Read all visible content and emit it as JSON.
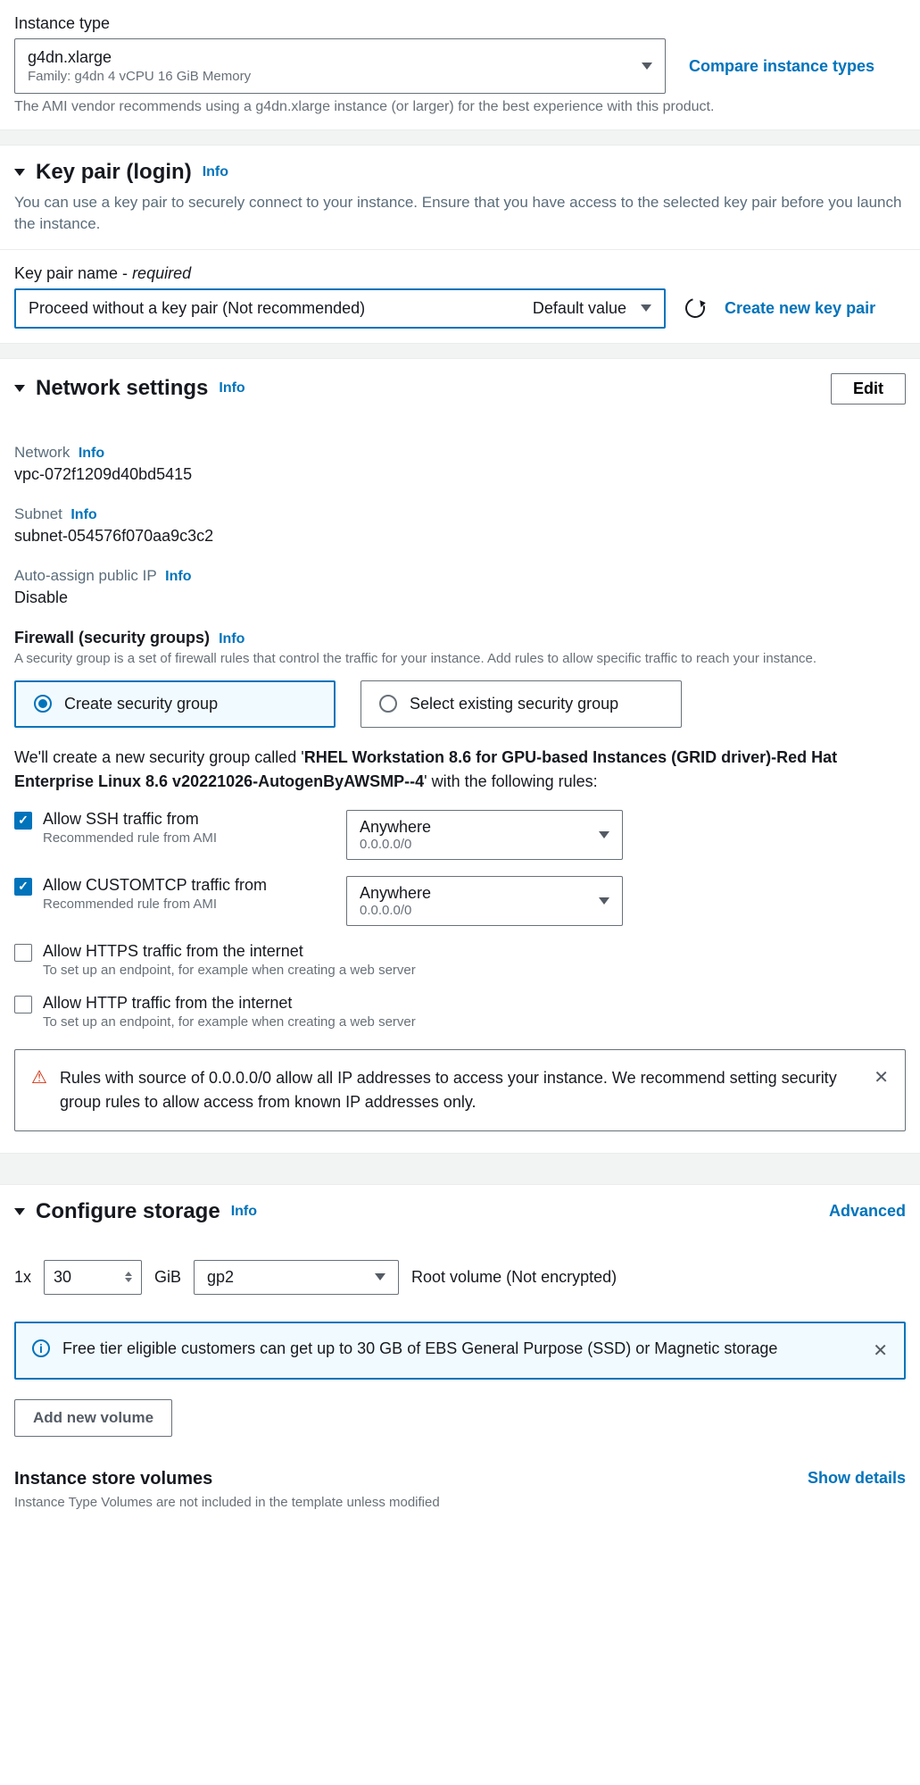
{
  "instanceType": {
    "label": "Instance type",
    "value": "g4dn.xlarge",
    "details": "Family: g4dn    4 vCPU    16 GiB Memory",
    "compareLink": "Compare instance types",
    "hint": "The AMI vendor recommends using a g4dn.xlarge instance (or larger) for the best experience with this product."
  },
  "keyPair": {
    "title": "Key pair (login)",
    "info": "Info",
    "desc": "You can use a key pair to securely connect to your instance. Ensure that you have access to the selected key pair before you launch the instance.",
    "nameLabel": "Key pair name - ",
    "required": "required",
    "selectValue": "Proceed without a key pair (Not recommended)",
    "selectHint": "Default value",
    "createLink": "Create new key pair"
  },
  "network": {
    "title": "Network settings",
    "info": "Info",
    "editBtn": "Edit",
    "networkLabel": "Network",
    "networkValue": "vpc-072f1209d40bd5415",
    "subnetLabel": "Subnet",
    "subnetValue": "subnet-054576f070aa9c3c2",
    "publicIpLabel": "Auto-assign public IP",
    "publicIpValue": "Disable",
    "firewallLabel": "Firewall (security groups)",
    "firewallDesc": "A security group is a set of firewall rules that control the traffic for your instance. Add rules to allow specific traffic to reach your instance.",
    "radioCreate": "Create security group",
    "radioSelect": "Select existing security group",
    "sgMsg1": "We'll create a new security group called '",
    "sgName": "RHEL Workstation 8.6 for GPU-based Instances (GRID driver)-Red Hat Enterprise Linux 8.6 v20221026-AutogenByAWSMP--4",
    "sgMsg2": "' with the following rules:",
    "rules": [
      {
        "checked": true,
        "label": "Allow SSH traffic from",
        "sub": "Recommended rule from AMI",
        "source": "Anywhere",
        "cidr": "0.0.0.0/0"
      },
      {
        "checked": true,
        "label": "Allow CUSTOMTCP traffic from",
        "sub": "Recommended rule from AMI",
        "source": "Anywhere",
        "cidr": "0.0.0.0/0"
      },
      {
        "checked": false,
        "label": "Allow HTTPS traffic from the internet",
        "sub": "To set up an endpoint, for example when creating a web server"
      },
      {
        "checked": false,
        "label": "Allow HTTP traffic from the internet",
        "sub": "To set up an endpoint, for example when creating a web server"
      }
    ],
    "warning": "Rules with source of 0.0.0.0/0 allow all IP addresses to access your instance. We recommend setting security group rules to allow access from known IP addresses only."
  },
  "storage": {
    "title": "Configure storage",
    "info": "Info",
    "advancedLink": "Advanced",
    "qtyPrefix": "1x",
    "size": "30",
    "unit": "GiB",
    "volType": "gp2",
    "rootLabel": "Root volume  (Not encrypted)",
    "freeTier": "Free tier eligible customers can get up to 30 GB of EBS General Purpose (SSD) or Magnetic storage",
    "addBtn": "Add new volume",
    "storeTitle": "Instance store volumes",
    "storeDesc": "Instance Type Volumes are not included in the template unless modified",
    "showDetails": "Show details"
  }
}
